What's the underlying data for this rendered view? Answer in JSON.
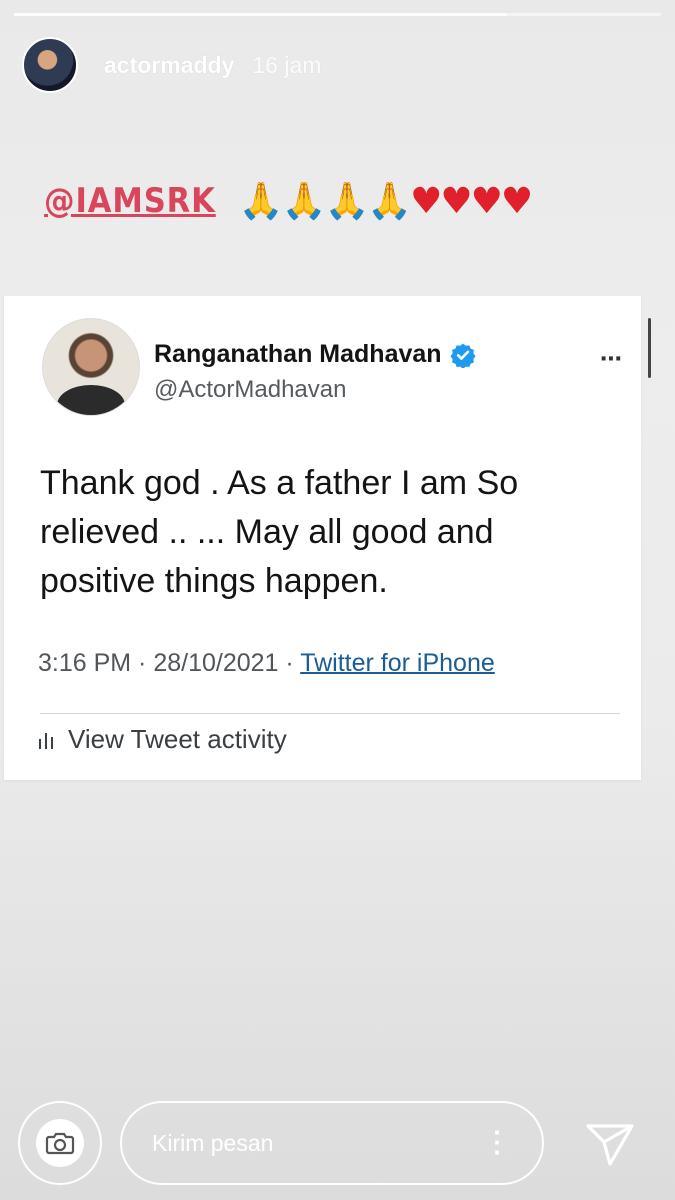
{
  "story": {
    "progress": 0.76,
    "username": "actormaddy",
    "time_ago": "16 jam"
  },
  "caption": {
    "mention": "@IAMSRK",
    "emojis": {
      "pray": "🙏🙏🙏🙏",
      "hearts": "♥♥♥♥"
    }
  },
  "tweet": {
    "display_name": "Ranganathan Madhavan",
    "handle": "@ActorMadhavan",
    "more_icon": "⋯",
    "body": "Thank god . As a father I am So relieved .. ... May all good and positive things happen.",
    "timestamp": "3:16 PM · 28/10/2021 · ",
    "source": "Twitter for iPhone",
    "activity_label": "View Tweet activity",
    "verified_color": "#1d9bf0"
  },
  "reply": {
    "placeholder": "Kirim pesan",
    "camera_icon": "camera-icon",
    "send_icon": "send-icon"
  },
  "colors": {
    "mention": "#d9455a",
    "link": "#1b5c94"
  }
}
